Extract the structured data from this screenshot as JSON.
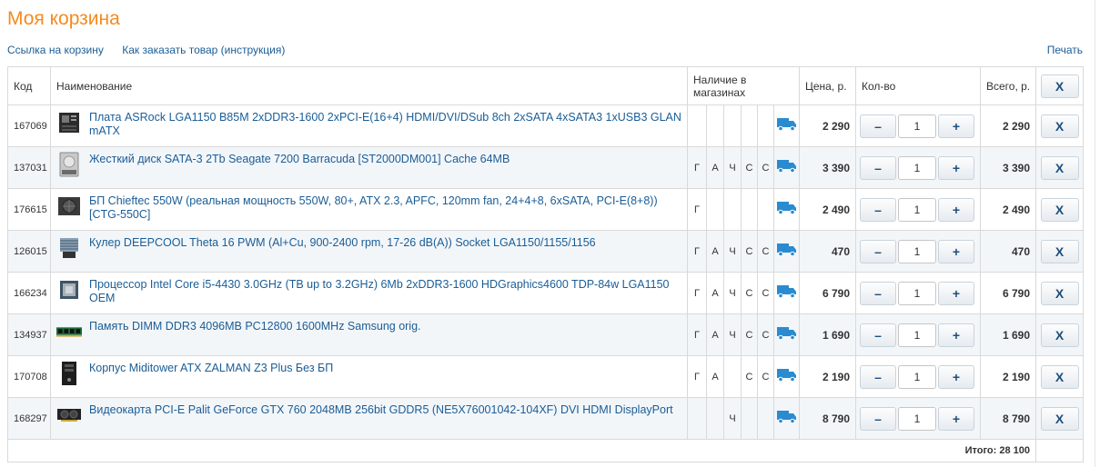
{
  "title": "Моя корзина",
  "links": {
    "cart_link": "Ссылка на корзину",
    "how_to_order": "Как заказать товар (инструкция)",
    "print": "Печать"
  },
  "headers": {
    "code": "Код",
    "name": "Наименование",
    "availability": "Наличие в магазинах",
    "price": "Цена, р.",
    "qty": "Кол-во",
    "total": "Всего, р.",
    "delete": "X"
  },
  "buttons": {
    "minus": "–",
    "plus": "+",
    "delete": "X"
  },
  "items": [
    {
      "code": "167069",
      "name": "Плата ASRock LGA1150 B85M 2xDDR3-1600 2xPCI-E(16+4) HDMI/DVI/DSub 8ch 2xSATA 4xSATA3 1xUSB3 GLAN mATX",
      "icon": "motherboard-icon",
      "stores": [
        "",
        "",
        "",
        "",
        ""
      ],
      "delivery": true,
      "price": "2 290",
      "qty": "1",
      "total": "2 290"
    },
    {
      "code": "137031",
      "name": "Жесткий диск SATA-3 2Tb Seagate 7200 Barracuda [ST2000DM001] Cache 64MB",
      "icon": "hard-drive-icon",
      "stores": [
        "Г",
        "А",
        "Ч",
        "С",
        "С"
      ],
      "delivery": true,
      "price": "3 390",
      "qty": "1",
      "total": "3 390"
    },
    {
      "code": "176615",
      "name": "БП Chieftec 550W (реальная мощность 550W, 80+, ATX 2.3, APFC, 120mm fan, 24+4+8, 6xSATA, PCI-E(8+8)) [CTG-550C]",
      "icon": "power-supply-icon",
      "stores": [
        "Г",
        "",
        "",
        "",
        ""
      ],
      "delivery": true,
      "price": "2 490",
      "qty": "1",
      "total": "2 490"
    },
    {
      "code": "126015",
      "name": "Кулер DEEPCOOL Theta 16 PWM (Al+Cu, 900-2400 rpm, 17-26 dB(A)) Socket LGA1150/1155/1156",
      "icon": "cooler-icon",
      "stores": [
        "Г",
        "А",
        "Ч",
        "С",
        "С"
      ],
      "delivery": true,
      "price": "470",
      "qty": "1",
      "total": "470"
    },
    {
      "code": "166234",
      "name": "Процессор Intel Core i5-4430 3.0GHz (TB up to 3.2GHz) 6Mb 2xDDR3-1600 HDGraphics4600 TDP-84w LGA1150 OEM",
      "icon": "cpu-icon",
      "stores": [
        "Г",
        "А",
        "Ч",
        "С",
        "С"
      ],
      "delivery": true,
      "price": "6 790",
      "qty": "1",
      "total": "6 790"
    },
    {
      "code": "134937",
      "name": "Память DIMM DDR3 4096MB PC12800 1600MHz Samsung orig.",
      "icon": "memory-icon",
      "stores": [
        "Г",
        "А",
        "Ч",
        "С",
        "С"
      ],
      "delivery": true,
      "price": "1 690",
      "qty": "1",
      "total": "1 690"
    },
    {
      "code": "170708",
      "name": "Корпус Miditower ATX ZALMAN Z3 Plus Без БП",
      "icon": "pc-case-icon",
      "stores": [
        "Г",
        "А",
        "",
        "С",
        "С"
      ],
      "delivery": true,
      "price": "2 190",
      "qty": "1",
      "total": "2 190"
    },
    {
      "code": "168297",
      "name": "Видеокарта PCI-E Palit GeForce GTX 760 2048MB 256bit GDDR5 (NE5X76001042-104XF) DVI HDMI DisplayPort",
      "icon": "video-card-icon",
      "stores": [
        "",
        "",
        "Ч",
        "",
        ""
      ],
      "delivery": true,
      "price": "8 790",
      "qty": "1",
      "total": "8 790"
    }
  ],
  "grand_total": "Итого: 28 100",
  "colors": {
    "title": "#f58a1f",
    "link": "#1a5d96",
    "truck": "#2a8bd0",
    "alt_row": "#f3f6f9"
  }
}
